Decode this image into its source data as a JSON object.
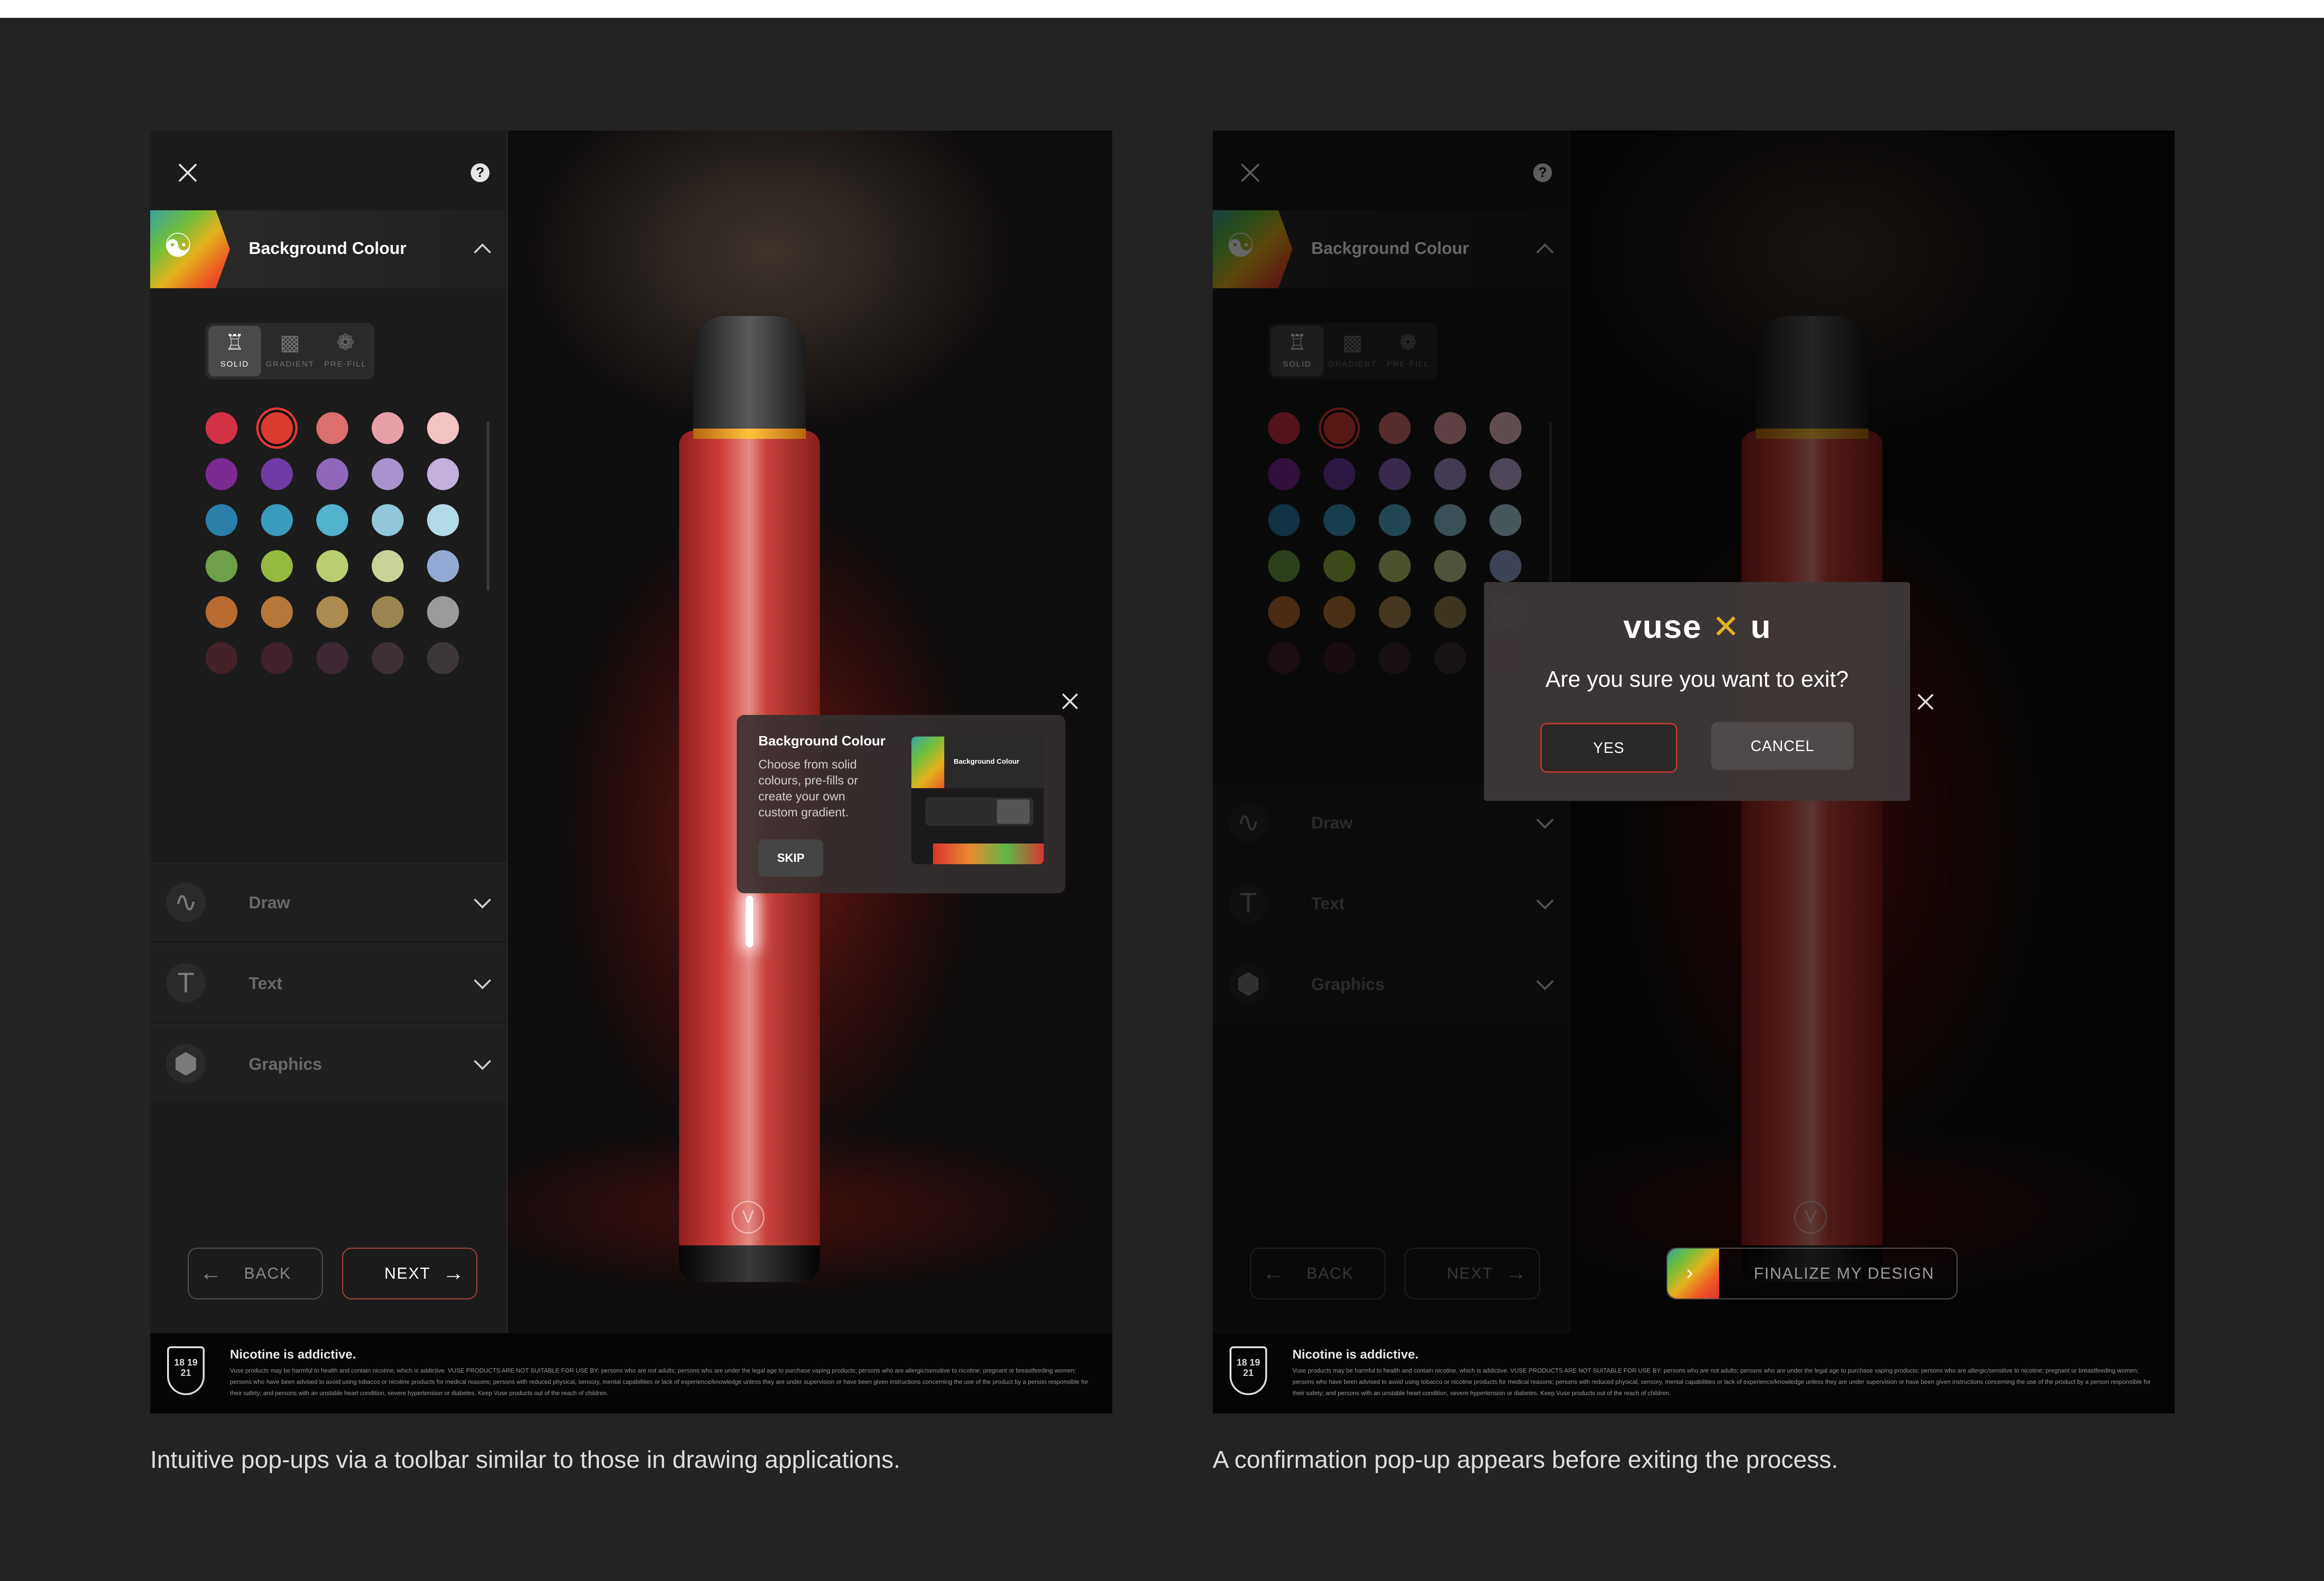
{
  "captions": {
    "left": "Intuitive pop-ups via a toolbar similar to those in drawing applications.",
    "right": "A confirmation pop-up appears before exiting the process."
  },
  "panel": {
    "background_colour_title": "Background Colour",
    "modes": [
      "SOLID",
      "GRADIENT",
      "PRE-FILL"
    ],
    "active_mode": "SOLID",
    "swatch_colors": [
      "#d33144",
      "#d93b2f",
      "#dc6e6e",
      "#e8a0a8",
      "#f1c3c3",
      "#7c2b93",
      "#6f3ba5",
      "#9068bb",
      "#a893cc",
      "#c3b0dc",
      "#2a7ea8",
      "#3a9bbf",
      "#53b2cd",
      "#91c6db",
      "#b2dae6",
      "#6ea04a",
      "#96b93f",
      "#b8ce70",
      "#c7d397",
      "#93a9d3",
      "#b96b30",
      "#b5783a",
      "#ad8a4f",
      "#9a8550",
      "#9b9b9b",
      "#7a2b3a",
      "#6e2a43",
      "#6b3a55",
      "#6a4b58",
      "#6a5a5c"
    ],
    "selected_swatch_color": "#d93b2f",
    "accordion": [
      "Draw",
      "Text",
      "Graphics"
    ],
    "back_label": "BACK",
    "next_label": "NEXT"
  },
  "onboarding_tip": {
    "title": "Background Colour",
    "text": "Choose from solid colours, pre-fills or create your own custom gradient.",
    "skip_label": "SKIP",
    "thumb_title": "Background Colour"
  },
  "exit_dialog": {
    "brand_left": "vuse",
    "brand_right": "u",
    "question": "Are you sure you want to exit?",
    "yes_label": "YES",
    "cancel_label": "CANCEL"
  },
  "finalize_label": "FINALIZE MY DESIGN",
  "footer": {
    "age_numbers": "18 19 21",
    "title": "Nicotine is addictive.",
    "text": "Vuse products may be harmful to health and contain nicotine, which is addictive. VUSE PRODUCTS ARE NOT SUITABLE FOR USE BY: persons who are not adults; persons who are under the legal age to purchase vaping products; persons who are allergic/sensitive to nicotine; pregnant or breastfeeding women; persons who have been advised to avoid using tobacco or nicotine products for medical reasons; persons with reduced physical, sensory, mental capabilities or lack of experience/knowledge unless they are under supervision or have been given instructions concerning the use of the product by a person responsible for their safety; and persons with an unstable heart condition, severe hypertension or diabetes. Keep Vuse products out of the reach of children."
  },
  "icons": {
    "help": "?",
    "undo": "undo-icon",
    "redo": "redo-icon",
    "trash": "trash-icon",
    "device_logo": "V"
  }
}
